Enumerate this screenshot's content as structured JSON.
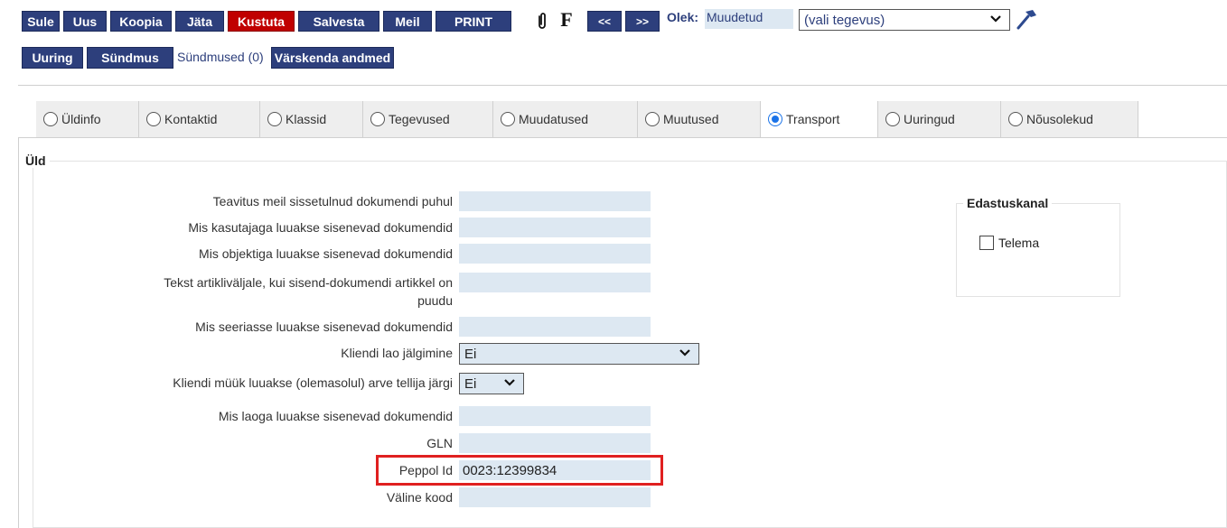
{
  "toolbar": {
    "sule": "Sule",
    "uus": "Uus",
    "koopia": "Koopia",
    "jata": "Jäta",
    "kustuta": "Kustuta",
    "salvesta": "Salvesta",
    "meil": "Meil",
    "print": "PRINT",
    "f_label": "F",
    "prev": "<<",
    "next": ">>",
    "olek_label": "Olek:",
    "olek_value": "Muudetud",
    "action_select": "(vali tegevus)",
    "uuring": "Uuring",
    "syndmus": "Sündmus",
    "syndmused_link": "Sündmused (0)",
    "varskenda": "Värskenda andmed"
  },
  "tabs": [
    {
      "label": "Üldinfo",
      "active": false
    },
    {
      "label": "Kontaktid",
      "active": false
    },
    {
      "label": "Klassid",
      "active": false
    },
    {
      "label": "Tegevused",
      "active": false
    },
    {
      "label": "Muudatused",
      "active": false
    },
    {
      "label": "Muutused",
      "active": false
    },
    {
      "label": "Transport",
      "active": true
    },
    {
      "label": "Uuringud",
      "active": false
    },
    {
      "label": "Nõusolekud",
      "active": false
    }
  ],
  "section": {
    "title": "Üld"
  },
  "fields": {
    "teavitus": {
      "label": "Teavitus meil sissetulnud dokumendi puhul",
      "value": ""
    },
    "kasutaja": {
      "label": "Mis kasutajaga luuakse sisenevad dokumendid",
      "value": ""
    },
    "objekt": {
      "label": "Mis objektiga luuakse sisenevad dokumendid",
      "value": ""
    },
    "tekst_line1": "Tekst artikliväljale, kui sisend-dokumendi artikkel on",
    "tekst_line2": "puudu",
    "tekst_value": "",
    "seeria": {
      "label": "Mis seeriasse luuakse sisenevad dokumendid",
      "value": ""
    },
    "ladu_jalg": {
      "label": "Kliendi lao jälgimine",
      "value": "Ei"
    },
    "myyk": {
      "label": "Kliendi müük luuakse (olemasolul) arve tellija järgi",
      "value": "Ei"
    },
    "ladu": {
      "label": "Mis laoga luuakse sisenevad dokumendid",
      "value": ""
    },
    "gln": {
      "label": "GLN",
      "value": ""
    },
    "peppol": {
      "label": "Peppol Id",
      "value": "0023:12399834"
    },
    "valine": {
      "label": "Väline kood",
      "value": ""
    }
  },
  "edastus": {
    "title": "Edastuskanal",
    "telema": "Telema",
    "telema_checked": false
  },
  "colors": {
    "button_bg": "#2d3f7c",
    "danger": "#c00000",
    "field_bg": "#dde8f2",
    "highlight": "#e02020",
    "radio_active": "#1a73e8"
  }
}
